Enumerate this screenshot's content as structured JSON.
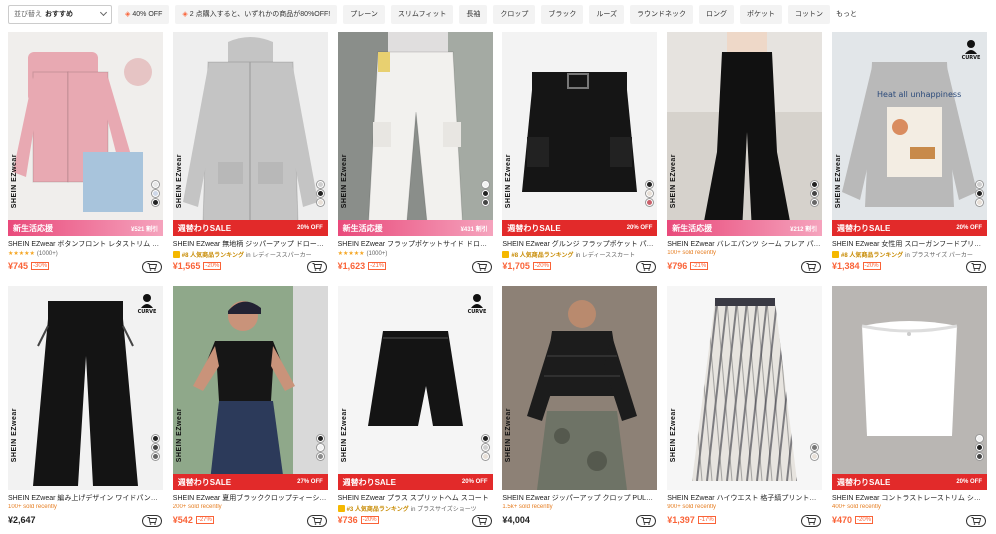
{
  "filters": {
    "sort_label": "並び替え",
    "sort_value": "おすすめ",
    "chips": [
      {
        "label": "40% OFF",
        "tag": true
      },
      {
        "label": "2 点購入すると、いずれかの商品が80%OFF!",
        "tag": true
      },
      {
        "label": "プレーン",
        "tag": false
      },
      {
        "label": "スリムフィット",
        "tag": false
      },
      {
        "label": "長袖",
        "tag": false
      },
      {
        "label": "クロップ",
        "tag": false
      },
      {
        "label": "ブラック",
        "tag": false
      },
      {
        "label": "ルーズ",
        "tag": false
      },
      {
        "label": "ラウンドネック",
        "tag": false
      },
      {
        "label": "ロング",
        "tag": false
      },
      {
        "label": "ポケット",
        "tag": false
      },
      {
        "label": "コットン",
        "tag": false
      }
    ],
    "more": "もっと"
  },
  "products": [
    {
      "title": "SHEIN EZwear ボタンフロント レタストリム …",
      "banner_type": "pink",
      "banner_left": "新生活応援",
      "banner_right": "¥521 割引",
      "meta_type": "stars",
      "stars": "★★★★★",
      "count": "(1000+)",
      "price": "¥745",
      "discount": "-30%",
      "brand": "SHEIN EZwear",
      "swatches": [
        "#e8e8e8",
        "#cfd8e8",
        "#222222"
      ],
      "curve": false,
      "curve_label": "",
      "img_bg": "#f0eeec",
      "garment_color": "#e8a9b2",
      "garment": "cardigan"
    },
    {
      "title": "SHEIN EZwear 無地柄 ジッパーアップ ドロー…",
      "banner_type": "red",
      "banner_left": "週替わりSALE",
      "banner_right": "20% OFF",
      "meta_type": "rank",
      "rank_label": "#8 人気商品ランキング",
      "rank_cat": "in レディーススパーカー",
      "price": "¥1,565",
      "discount": "-20%",
      "brand": "SHEIN EZwear",
      "swatches": [
        "#cfcfcf",
        "#222222",
        "#e8e0d8"
      ],
      "curve": false,
      "curve_label": "",
      "img_bg": "#eeeeee",
      "garment_color": "#c4c4c4",
      "garment": "hoodie"
    },
    {
      "title": "SHEIN EZwear フラップポケットサイド ドロ…",
      "banner_type": "pink",
      "banner_left": "新生活応援",
      "banner_right": "¥431 割引",
      "meta_type": "stars",
      "stars": "★★★★★",
      "count": "(1000+)",
      "price": "¥1,623",
      "discount": "-21%",
      "brand": "SHEIN EZwear",
      "swatches": [
        "#f2f2f2",
        "#222222",
        "#444444"
      ],
      "curve": false,
      "curve_label": "",
      "img_bg": "#8a8e8a",
      "garment_color": "#f2f1ee",
      "garment": "pants"
    },
    {
      "title": "SHEIN EZwear グルンジ フラップポケット パ…",
      "banner_type": "red",
      "banner_left": "週替わりSALE",
      "banner_right": "20% OFF",
      "meta_type": "rank",
      "rank_label": "#8 人気商品ランキング",
      "rank_cat": "in レディーススカート",
      "price": "¥1,705",
      "discount": "-20%",
      "brand": "SHEIN EZwear",
      "swatches": [
        "#222222",
        "#e8e0d8",
        "#c9606a"
      ],
      "curve": false,
      "curve_label": "",
      "img_bg": "#f3f3f3",
      "garment_color": "#151515",
      "garment": "skirt"
    },
    {
      "title": "SHEIN EZwear バレエパンツ シーム フレア パ…",
      "banner_type": "pink",
      "banner_left": "新生活応援",
      "banner_right": "¥212 割引",
      "meta_type": "sold",
      "sold": "100+ sold recently",
      "price": "¥796",
      "discount": "-21%",
      "brand": "SHEIN EZwear",
      "swatches": [
        "#222222",
        "#444444",
        "#666666"
      ],
      "curve": false,
      "curve_label": "",
      "img_bg": "#e6e3df",
      "garment_color": "#111111",
      "garment": "flare"
    },
    {
      "title": "SHEIN EZwear 女性用 スローガンフードプリ…",
      "banner_type": "red",
      "banner_left": "週替わりSALE",
      "banner_right": "20% OFF",
      "meta_type": "rank",
      "rank_label": "#8 人気商品ランキング",
      "rank_cat": "in プラスサイズ パーカー",
      "price": "¥1,384",
      "discount": "-20%",
      "brand": "SHEIN EZwear",
      "swatches": [
        "#cfcfcf",
        "#222222",
        "#e8e0d8"
      ],
      "curve": true,
      "curve_label": "CURVE",
      "img_bg": "#e2e6e9",
      "garment_color": "#b9b9b9",
      "garment": "sweat"
    },
    {
      "title": "SHEIN EZwear 編み上げデザイン ワイドパン…",
      "banner_type": "none",
      "banner_left": "",
      "banner_right": "",
      "meta_type": "sold",
      "sold": "100+ sold recently",
      "price": "¥2,647",
      "discount": "",
      "brand": "SHEIN EZwear",
      "swatches": [
        "#222222",
        "#444444",
        "#666666"
      ],
      "curve": true,
      "curve_label": "CURVE",
      "img_bg": "#f2f2f2",
      "garment_color": "#141414",
      "garment": "wide"
    },
    {
      "title": "SHEIN EZwear 夏用ブラッククロップティーシ…",
      "banner_type": "red",
      "banner_left": "週替わりSALE",
      "banner_right": "27% OFF",
      "meta_type": "sold",
      "sold": "200+ sold recently",
      "price": "¥542",
      "discount": "-27%",
      "brand": "SHEIN EZwear",
      "swatches": [
        "#222222",
        "#f2f2f2",
        "#8a8a8a"
      ],
      "curve": false,
      "curve_label": "",
      "img_bg": "#8fa88a",
      "garment_color": "#161616",
      "garment": "tee"
    },
    {
      "title": "SHEIN EZwear プラス スプリットヘム スコート",
      "banner_type": "red",
      "banner_left": "週替わりSALE",
      "banner_right": "20% OFF",
      "meta_type": "rank",
      "rank_label": "#3 人気商品ランキング",
      "rank_cat": "in プラスサイズショーツ",
      "price": "¥736",
      "discount": "-20%",
      "brand": "SHEIN EZwear",
      "swatches": [
        "#222222",
        "#cfcfcf",
        "#e8e0d8"
      ],
      "curve": true,
      "curve_label": "CURVE",
      "img_bg": "#f5f5f5",
      "garment_color": "#141414",
      "garment": "skort"
    },
    {
      "title": "SHEIN EZwear ジッパーアップ クロップ PUL…",
      "banner_type": "none",
      "banner_left": "",
      "banner_right": "",
      "meta_type": "sold",
      "sold": "1.5k+ sold recently",
      "price": "¥4,004",
      "discount": "",
      "brand": "SHEIN EZwear",
      "swatches": [],
      "curve": false,
      "curve_label": "",
      "img_bg": "#9b8f86",
      "garment_color": "#1c1c1c",
      "garment": "puffer"
    },
    {
      "title": "SHEIN EZwear ハイウエスト 格子縞プリント…",
      "banner_type": "none",
      "banner_left": "",
      "banner_right": "",
      "meta_type": "sold",
      "sold": "900+ sold recently",
      "price": "¥1,397",
      "discount": "-17%",
      "brand": "SHEIN EZwear",
      "swatches": [
        "#777777",
        "#e8e0d8"
      ],
      "curve": false,
      "curve_label": "",
      "img_bg": "#f6f6f6",
      "garment_color": "#3a3a44",
      "garment": "plaid"
    },
    {
      "title": "SHEIN EZwear コントラストレーストリム シ…",
      "banner_type": "red",
      "banner_left": "週替わりSALE",
      "banner_right": "20% OFF",
      "meta_type": "sold",
      "sold": "400+ sold recently",
      "price": "¥470",
      "discount": "-20%",
      "brand": "",
      "swatches": [
        "#f2f2f2",
        "#222222",
        "#444444"
      ],
      "curve": false,
      "curve_label": "",
      "img_bg": "#b9b6b3",
      "garment_color": "#ffffff",
      "garment": "tube"
    }
  ]
}
